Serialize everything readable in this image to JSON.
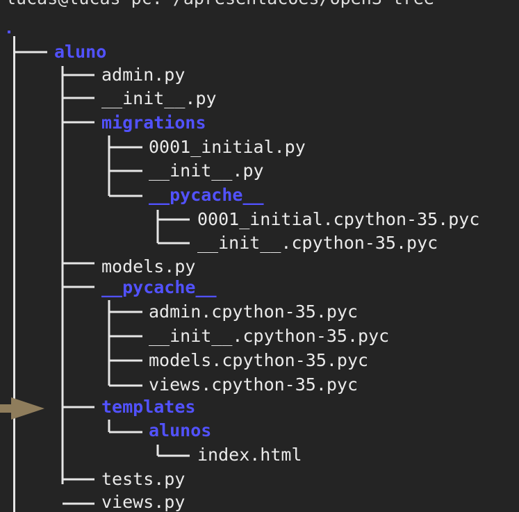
{
  "terminal": {
    "prompt": "lucas@lucas-pc:~/apresentacoes/openS tree",
    "root": ".",
    "entries": [
      {
        "name": "aluno",
        "type": "dir"
      },
      {
        "name": "admin.py",
        "type": "file"
      },
      {
        "name": "__init__.py",
        "type": "file"
      },
      {
        "name": "migrations",
        "type": "dir"
      },
      {
        "name": "0001_initial.py",
        "type": "file"
      },
      {
        "name": "__init__.py",
        "type": "file"
      },
      {
        "name": "__pycache__",
        "type": "dir"
      },
      {
        "name": "0001_initial.cpython-35.pyc",
        "type": "file"
      },
      {
        "name": "__init__.cpython-35.pyc",
        "type": "file"
      },
      {
        "name": "models.py",
        "type": "file"
      },
      {
        "name": "__pycache__",
        "type": "dir"
      },
      {
        "name": "admin.cpython-35.pyc",
        "type": "file"
      },
      {
        "name": "__init__.cpython-35.pyc",
        "type": "file"
      },
      {
        "name": "models.cpython-35.pyc",
        "type": "file"
      },
      {
        "name": "views.cpython-35.pyc",
        "type": "file"
      },
      {
        "name": "templates",
        "type": "dir"
      },
      {
        "name": "alunos",
        "type": "dir"
      },
      {
        "name": "index.html",
        "type": "file"
      },
      {
        "name": "tests.py",
        "type": "file"
      },
      {
        "name": "views.py",
        "type": "file"
      }
    ]
  },
  "colors": {
    "background": "#242424",
    "text": "#eaeaea",
    "directory": "#5252ff",
    "annotation_arrow": "#8f7d5c"
  },
  "annotation": {
    "icon": "pointer-arrow-icon",
    "target": "templates"
  }
}
